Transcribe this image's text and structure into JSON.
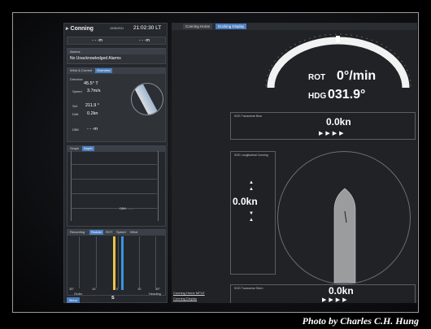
{
  "left": {
    "title": "Conning",
    "date": "16/06/2011",
    "time": "21:02:30 LT",
    "row_top": {
      "left_val": "- - -m",
      "right_val": "- - -m"
    },
    "alarms": {
      "header": "Alarms",
      "text": "No Unacknowledged Alarms"
    },
    "wind_tabs": [
      "Wind & Current",
      "Overview"
    ],
    "wind": {
      "dir_label": "Direction",
      "dir_value": "45.5° T",
      "speed_label": "Speed",
      "speed_value": "3.7m/s",
      "set_label": "Set",
      "set_value": "211.9 °",
      "drift_label": "Drift",
      "drift_value": "0.2kn",
      "depth_label": "DBK",
      "depth_value": "- - -m"
    },
    "graph_tabs": [
      "Graph",
      "Depth"
    ],
    "graph_readout": "DBK: - - -",
    "rudder_tabs": [
      "Recording",
      "Rudder",
      "ROT",
      "Speed",
      "Wind"
    ],
    "rudder_scale": [
      "35°",
      "20",
      "10",
      "0",
      "10",
      "20",
      "35°"
    ],
    "legend": [
      "Order",
      "Heading"
    ],
    "menu_button": "Menu",
    "bottom_icons": "S"
  },
  "main": {
    "tabs": [
      "Conning Home",
      "Docking Display"
    ],
    "rot_label": "ROT",
    "rot_value": "0°/min",
    "hdg_label": "HDG",
    "hdg_value": "031.9°",
    "transverse_bow": {
      "title": "SOG Transverse Bow",
      "value": "0.0kn",
      "arrows": "▶▶▶▶"
    },
    "longitudinal": {
      "title": "SOG Longitudinal Conning",
      "value": "0.0kn"
    },
    "transverse_stern": {
      "title": "SOG Transverse Stern",
      "value": "0.0kn",
      "arrows": "▶▶▶▶"
    },
    "footer_links": [
      "Conning Home MPLE",
      "Conning Display"
    ]
  },
  "credit": "Photo by Charles C.H. Hung"
}
